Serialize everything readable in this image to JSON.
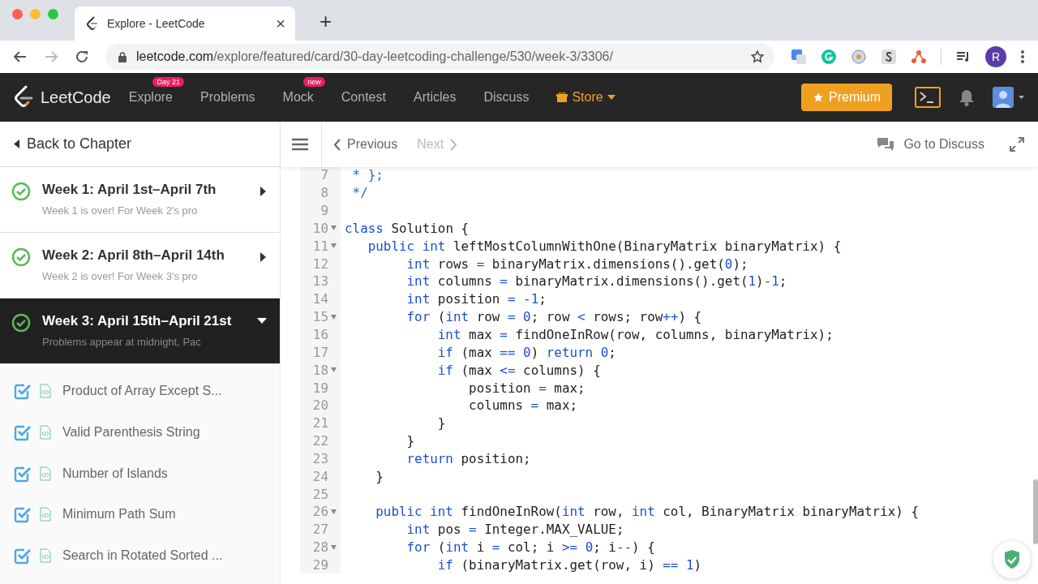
{
  "browser": {
    "tabs": [
      {
        "title": "Explore - LeetCode",
        "selected": true
      }
    ],
    "close": "×",
    "new_tab": "+",
    "url": {
      "domain": "leetcode.com",
      "path": "/explore/featured/card/30-day-leetcoding-challenge/530/week-3/3306/"
    },
    "profile": "R"
  },
  "nav": {
    "logo": "LeetCode",
    "items": [
      {
        "label": "Explore",
        "badge": "Day 21"
      },
      {
        "label": "Problems"
      },
      {
        "label": "Mock",
        "badge": "new"
      },
      {
        "label": "Contest"
      },
      {
        "label": "Articles"
      },
      {
        "label": "Discuss"
      }
    ],
    "store": "Store",
    "premium": "Premium"
  },
  "sidebar": {
    "back": "Back to Chapter",
    "weeks": [
      {
        "title": "Week 1: April 1st–April 7th",
        "subtitle": "Week 1 is over! For Week 2's pro",
        "completed": true,
        "expanded": false
      },
      {
        "title": "Week 2: April 8th–April 14th",
        "subtitle": "Week 2 is over! For Week 3's pro",
        "completed": true,
        "expanded": false
      },
      {
        "title": "Week 3: April 15th–April 21st",
        "subtitle": "Problems appear at midnight, Pac",
        "completed": true,
        "expanded": true
      }
    ],
    "problems": [
      {
        "title": "Product of Array Except S...",
        "checked": true
      },
      {
        "title": "Valid Parenthesis String",
        "checked": true
      },
      {
        "title": "Number of Islands",
        "checked": true
      },
      {
        "title": "Minimum Path Sum",
        "checked": true
      },
      {
        "title": "Search in Rotated Sorted ...",
        "checked": true
      }
    ]
  },
  "toolbar": {
    "previous": {
      "label": "Previous",
      "disabled": false
    },
    "next": {
      "label": "Next",
      "disabled": true
    },
    "discuss": "Go to Discuss"
  },
  "code": {
    "lines": [
      {
        "n": "7",
        "fold": false,
        "tokens": [
          {
            "text": " * };",
            "kind": "comment"
          }
        ]
      },
      {
        "n": "8",
        "fold": false,
        "tokens": [
          {
            "text": " */",
            "kind": "comment"
          }
        ]
      },
      {
        "n": "9",
        "fold": false
      },
      {
        "n": "10",
        "fold": true,
        "tokens": [
          {
            "text": "class",
            "kind": "keyword"
          },
          {
            "text": " Solution {",
            "kind": "plain"
          }
        ]
      },
      {
        "n": "11",
        "fold": true,
        "tokens": [
          {
            "text": "   public int",
            "kind": "keyword"
          },
          {
            "text": " leftMostColumnWithOne(BinaryMatrix binaryMatrix) {",
            "kind": "plain"
          }
        ]
      },
      {
        "n": "12",
        "fold": false,
        "tokens": [
          {
            "text": "        int",
            "kind": "keyword"
          },
          {
            "text": " rows ",
            "kind": "plain"
          },
          {
            "text": "=",
            "kind": "keyword"
          },
          {
            "text": " binaryMatrix.dimensions().get(",
            "kind": "plain"
          },
          {
            "text": "0",
            "kind": "number"
          },
          {
            "text": ");",
            "kind": "plain"
          }
        ]
      },
      {
        "n": "13",
        "fold": false,
        "tokens": [
          {
            "text": "        int",
            "kind": "keyword"
          },
          {
            "text": " columns ",
            "kind": "plain"
          },
          {
            "text": "=",
            "kind": "keyword"
          },
          {
            "text": " binaryMatrix.dimensions().get(",
            "kind": "plain"
          },
          {
            "text": "1",
            "kind": "number"
          },
          {
            "text": ")",
            "kind": "plain"
          },
          {
            "text": "-1",
            "kind": "number"
          },
          {
            "text": ";",
            "kind": "plain"
          }
        ]
      },
      {
        "n": "14",
        "fold": false,
        "tokens": [
          {
            "text": "        int",
            "kind": "keyword"
          },
          {
            "text": " position ",
            "kind": "plain"
          },
          {
            "text": "=",
            "kind": "keyword"
          },
          {
            "text": " -1",
            "kind": "number"
          },
          {
            "text": ";",
            "kind": "plain"
          }
        ]
      },
      {
        "n": "15",
        "fold": true,
        "tokens": [
          {
            "text": "        for",
            "kind": "keyword"
          },
          {
            "text": " (",
            "kind": "plain"
          },
          {
            "text": "int",
            "kind": "keyword"
          },
          {
            "text": " row ",
            "kind": "plain"
          },
          {
            "text": "=",
            "kind": "keyword"
          },
          {
            "text": " 0",
            "kind": "number"
          },
          {
            "text": "; row ",
            "kind": "plain"
          },
          {
            "text": "<",
            "kind": "keyword"
          },
          {
            "text": " rows; row",
            "kind": "plain"
          },
          {
            "text": "++",
            "kind": "keyword"
          },
          {
            "text": ") {",
            "kind": "plain"
          }
        ]
      },
      {
        "n": "16",
        "fold": false,
        "tokens": [
          {
            "text": "            int",
            "kind": "keyword"
          },
          {
            "text": " max ",
            "kind": "plain"
          },
          {
            "text": "=",
            "kind": "keyword"
          },
          {
            "text": " findOneInRow(row, columns, binaryMatrix);",
            "kind": "plain"
          }
        ]
      },
      {
        "n": "17",
        "fold": false,
        "tokens": [
          {
            "text": "            if",
            "kind": "keyword"
          },
          {
            "text": " (max ",
            "kind": "plain"
          },
          {
            "text": "==",
            "kind": "keyword"
          },
          {
            "text": " 0",
            "kind": "number"
          },
          {
            "text": ") ",
            "kind": "plain"
          },
          {
            "text": "return",
            "kind": "keyword"
          },
          {
            "text": " 0",
            "kind": "number"
          },
          {
            "text": ";",
            "kind": "plain"
          }
        ]
      },
      {
        "n": "18",
        "fold": true,
        "tokens": [
          {
            "text": "            if",
            "kind": "keyword"
          },
          {
            "text": " (max ",
            "kind": "plain"
          },
          {
            "text": "<=",
            "kind": "keyword"
          },
          {
            "text": " columns) {",
            "kind": "plain"
          }
        ]
      },
      {
        "n": "19",
        "fold": false,
        "tokens": [
          {
            "text": "                position ",
            "kind": "plain"
          },
          {
            "text": "=",
            "kind": "keyword"
          },
          {
            "text": " max;",
            "kind": "plain"
          }
        ]
      },
      {
        "n": "20",
        "fold": false,
        "tokens": [
          {
            "text": "                columns ",
            "kind": "plain"
          },
          {
            "text": "=",
            "kind": "keyword"
          },
          {
            "text": " max;",
            "kind": "plain"
          }
        ]
      },
      {
        "n": "21",
        "fold": false,
        "tokens": [
          {
            "text": "            }",
            "kind": "plain"
          }
        ]
      },
      {
        "n": "22",
        "fold": false,
        "tokens": [
          {
            "text": "        }",
            "kind": "plain"
          }
        ]
      },
      {
        "n": "23",
        "fold": false,
        "tokens": [
          {
            "text": "        return",
            "kind": "keyword"
          },
          {
            "text": " position;",
            "kind": "plain"
          }
        ]
      },
      {
        "n": "24",
        "fold": false,
        "tokens": [
          {
            "text": "    }",
            "kind": "plain"
          }
        ]
      },
      {
        "n": "25",
        "fold": false
      },
      {
        "n": "26",
        "fold": true,
        "tokens": [
          {
            "text": "    public int",
            "kind": "keyword"
          },
          {
            "text": " findOneInRow(",
            "kind": "plain"
          },
          {
            "text": "int",
            "kind": "keyword"
          },
          {
            "text": " row, ",
            "kind": "plain"
          },
          {
            "text": "int",
            "kind": "keyword"
          },
          {
            "text": " col, BinaryMatrix binaryMatrix) {",
            "kind": "plain"
          }
        ]
      },
      {
        "n": "27",
        "fold": false,
        "tokens": [
          {
            "text": "        int",
            "kind": "keyword"
          },
          {
            "text": " pos ",
            "kind": "plain"
          },
          {
            "text": "=",
            "kind": "keyword"
          },
          {
            "text": " Integer.MAX_VALUE;",
            "kind": "plain"
          }
        ]
      },
      {
        "n": "28",
        "fold": true,
        "tokens": [
          {
            "text": "        for",
            "kind": "keyword"
          },
          {
            "text": " (",
            "kind": "plain"
          },
          {
            "text": "int",
            "kind": "keyword"
          },
          {
            "text": " i ",
            "kind": "plain"
          },
          {
            "text": "=",
            "kind": "keyword"
          },
          {
            "text": " col; i ",
            "kind": "plain"
          },
          {
            "text": ">=",
            "kind": "keyword"
          },
          {
            "text": " 0",
            "kind": "number"
          },
          {
            "text": "; i",
            "kind": "plain"
          },
          {
            "text": "--",
            "kind": "keyword"
          },
          {
            "text": ") {",
            "kind": "plain"
          }
        ]
      },
      {
        "n": "29",
        "fold": false,
        "tokens": [
          {
            "text": "            if",
            "kind": "keyword"
          },
          {
            "text": " (binaryMatrix.get(row, i) ",
            "kind": "plain"
          },
          {
            "text": "==",
            "kind": "keyword"
          },
          {
            "text": " 1",
            "kind": "number"
          },
          {
            "text": ")",
            "kind": "plain"
          }
        ]
      }
    ]
  }
}
